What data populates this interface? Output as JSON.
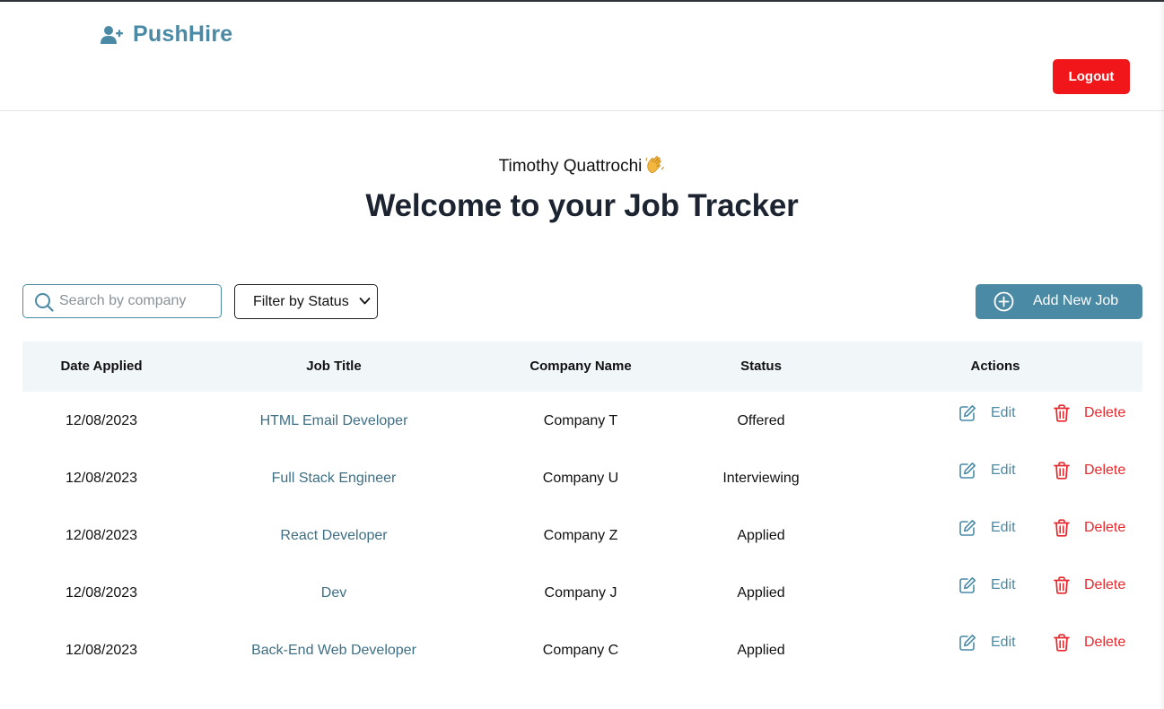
{
  "header": {
    "brand_name": "PushHire",
    "logout_label": "Logout"
  },
  "greeting": {
    "user_name": "Timothy Quattrochi",
    "title": "Welcome to your Job Tracker"
  },
  "toolbar": {
    "search_placeholder": "Search by company",
    "filter_label": "Filter by Status",
    "add_label": "Add New Job"
  },
  "table": {
    "columns": [
      "Date Applied",
      "Job Title",
      "Company Name",
      "Status",
      "Actions"
    ],
    "edit_label": "Edit",
    "delete_label": "Delete",
    "rows": [
      {
        "date": "12/08/2023",
        "title": "HTML Email Developer",
        "company": "Company T",
        "status": "Offered"
      },
      {
        "date": "12/08/2023",
        "title": "Full Stack Engineer",
        "company": "Company U",
        "status": "Interviewing"
      },
      {
        "date": "12/08/2023",
        "title": "React Developer",
        "company": "Company Z",
        "status": "Applied"
      },
      {
        "date": "12/08/2023",
        "title": "Dev",
        "company": "Company J",
        "status": "Applied"
      },
      {
        "date": "12/08/2023",
        "title": "Back-End Web Developer",
        "company": "Company C",
        "status": "Applied"
      }
    ]
  },
  "colors": {
    "brand": "#4a8aa5",
    "danger": "#f0161a",
    "header_row": "#f1f6f9",
    "title": "#1b2430"
  },
  "icons": {
    "brand": "user-plus-icon",
    "search": "search-icon",
    "filter": "chevron-down-icon",
    "add": "plus-circle-icon",
    "edit": "edit-icon",
    "delete": "trash-icon",
    "greeting": "waving-hand-icon"
  }
}
